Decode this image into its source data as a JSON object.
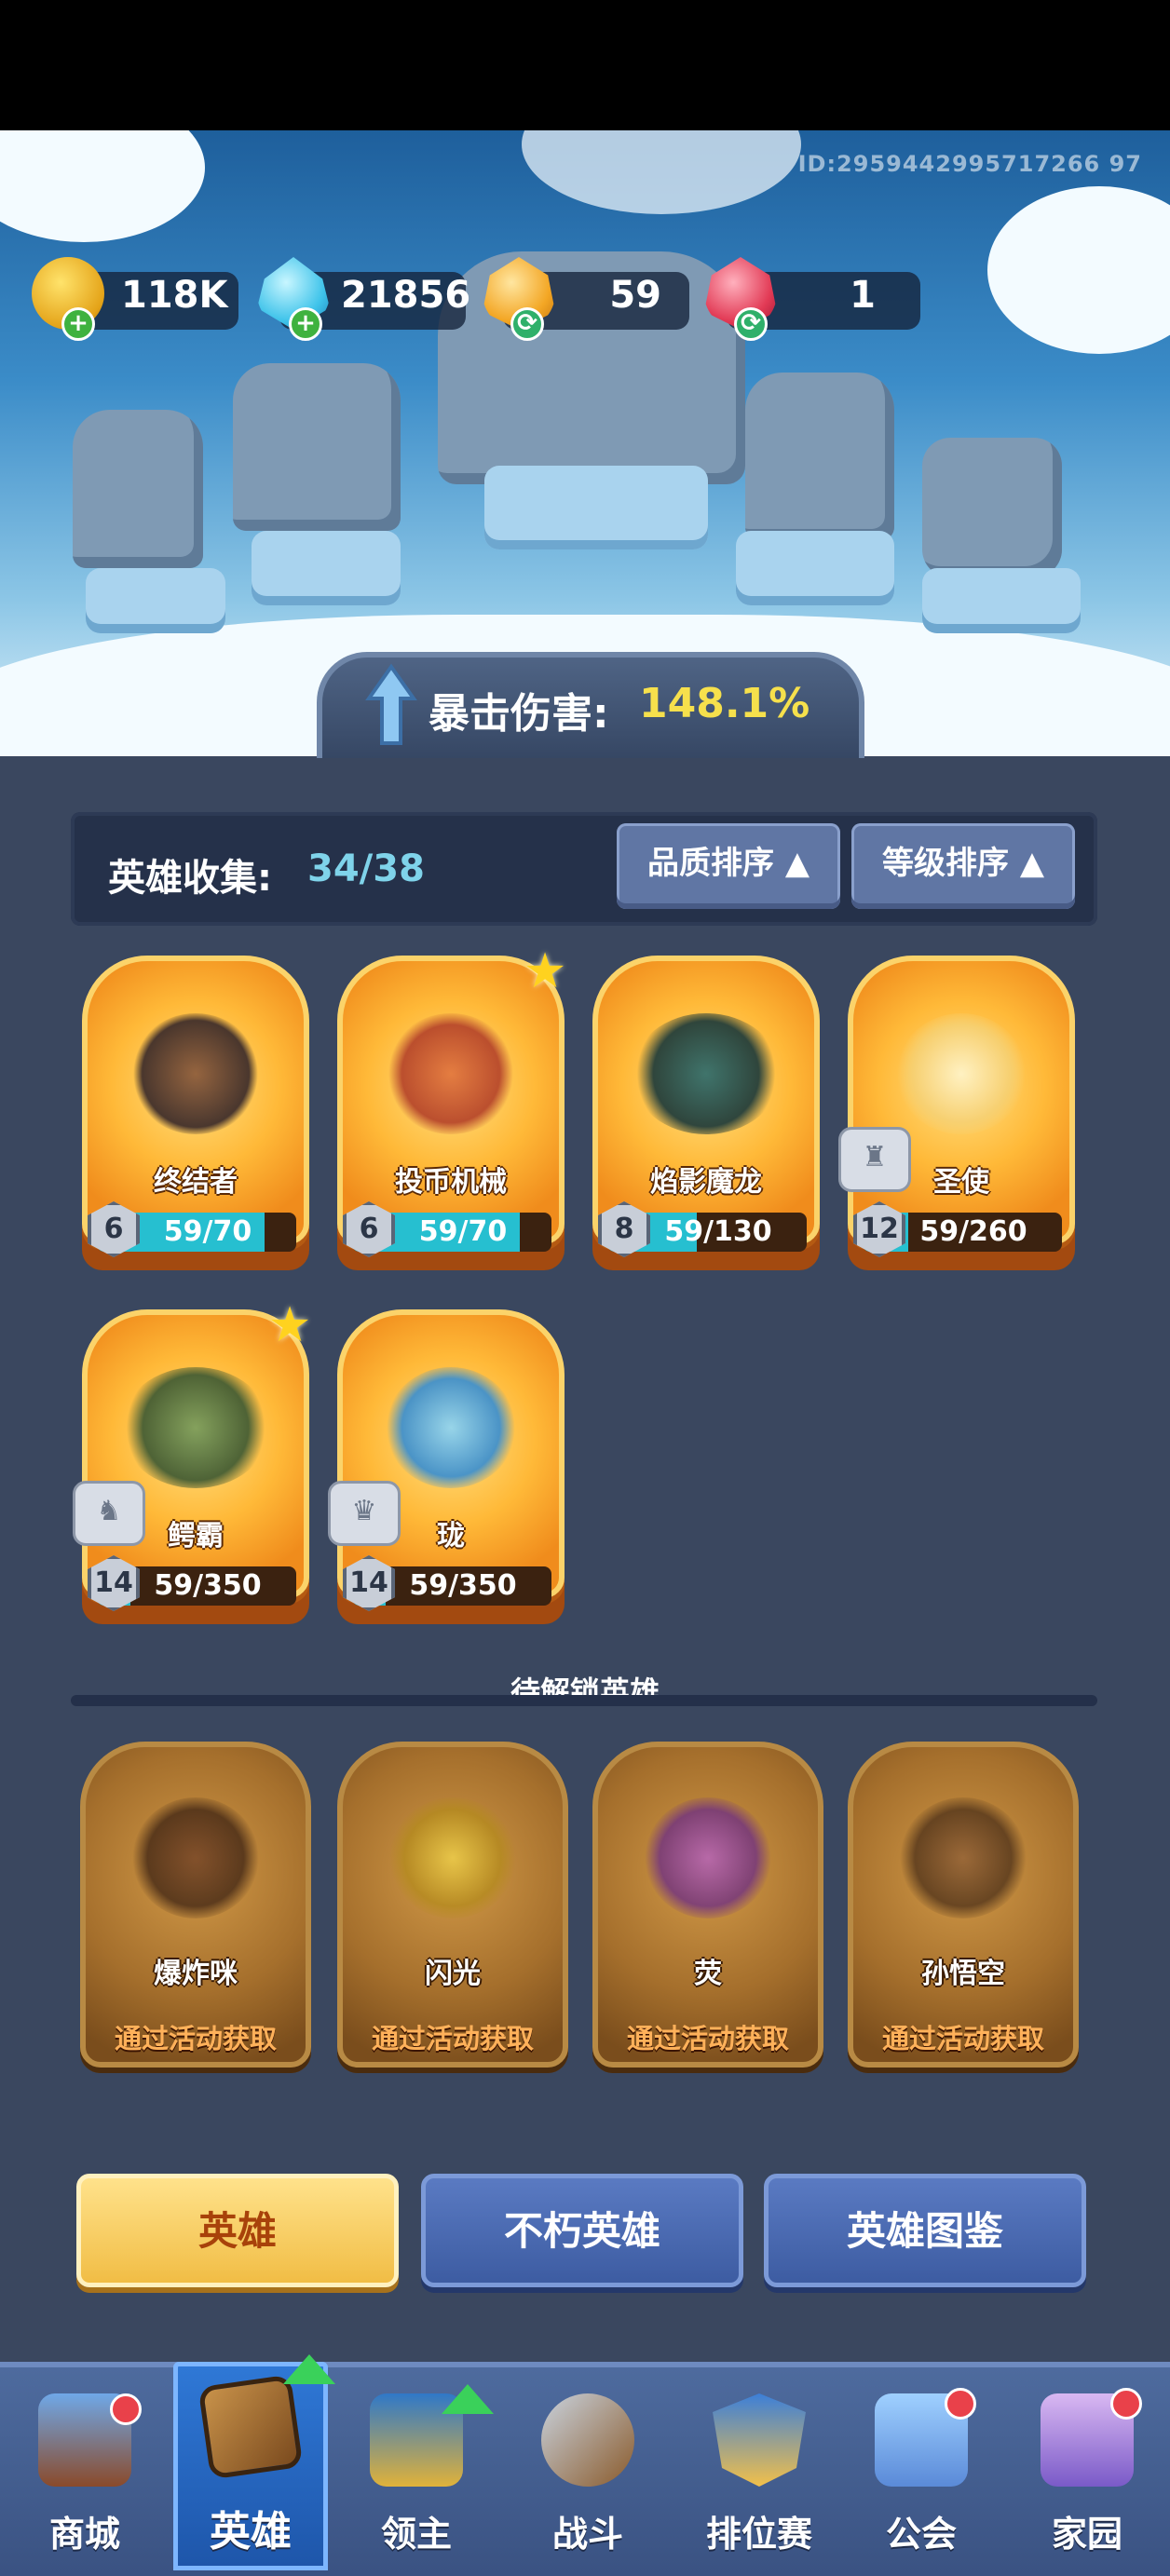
{
  "player_id": "ID:2959442995717266 97",
  "resources": [
    {
      "name": "gold",
      "icon": "gold-coin-icon",
      "value": "118K"
    },
    {
      "name": "diamond",
      "icon": "blue-crystal-icon",
      "value": "21856"
    },
    {
      "name": "orange-gem",
      "icon": "orange-crystal-icon",
      "value": "59"
    },
    {
      "name": "red-gem",
      "icon": "red-crystal-icon",
      "value": "1"
    }
  ],
  "crit": {
    "label": "暴击伤害:",
    "value": "148.1%"
  },
  "collection": {
    "label": "英雄收集:",
    "count": "34/38"
  },
  "sort": {
    "quality": "品质排序",
    "level": "等级排序"
  },
  "heroes": [
    {
      "name": "终结者",
      "level": "6",
      "progress": "59/70",
      "fraction": 0.84,
      "star": false,
      "badge": false
    },
    {
      "name": "投币机械",
      "level": "6",
      "progress": "59/70",
      "fraction": 0.84,
      "star": true,
      "badge": false
    },
    {
      "name": "焰影魔龙",
      "level": "8",
      "progress": "59/130",
      "fraction": 0.45,
      "star": false,
      "badge": false
    },
    {
      "name": "圣使",
      "level": "12",
      "progress": "59/260",
      "fraction": 0.23,
      "star": false,
      "badge": true
    },
    {
      "name": "鳄霸",
      "level": "14",
      "progress": "59/350",
      "fraction": 0.17,
      "star": true,
      "badge": true
    },
    {
      "name": "珑",
      "level": "14",
      "progress": "59/350",
      "fraction": 0.17,
      "star": false,
      "badge": true
    }
  ],
  "locked_title": "待解锁英雄",
  "locked_heroes": [
    {
      "name": "爆炸咪",
      "hint": "通过活动获取"
    },
    {
      "name": "闪光",
      "hint": "通过活动获取"
    },
    {
      "name": "荧",
      "hint": "通过活动获取"
    },
    {
      "name": "孙悟空",
      "hint": "通过活动获取"
    }
  ],
  "tabs": {
    "heroes": "英雄",
    "immortal": "不朽英雄",
    "codex": "英雄图鉴"
  },
  "nav": [
    {
      "label": "商城",
      "icon": "shop-chest-icon"
    },
    {
      "label": "英雄",
      "icon": "hero-card-icon"
    },
    {
      "label": "领主",
      "icon": "lord-banner-icon"
    },
    {
      "label": "战斗",
      "icon": "battle-sword-icon"
    },
    {
      "label": "排位赛",
      "icon": "ranked-shield-icon"
    },
    {
      "label": "公会",
      "icon": "guild-castle-icon"
    },
    {
      "label": "家园",
      "icon": "home-castle-icon"
    }
  ]
}
